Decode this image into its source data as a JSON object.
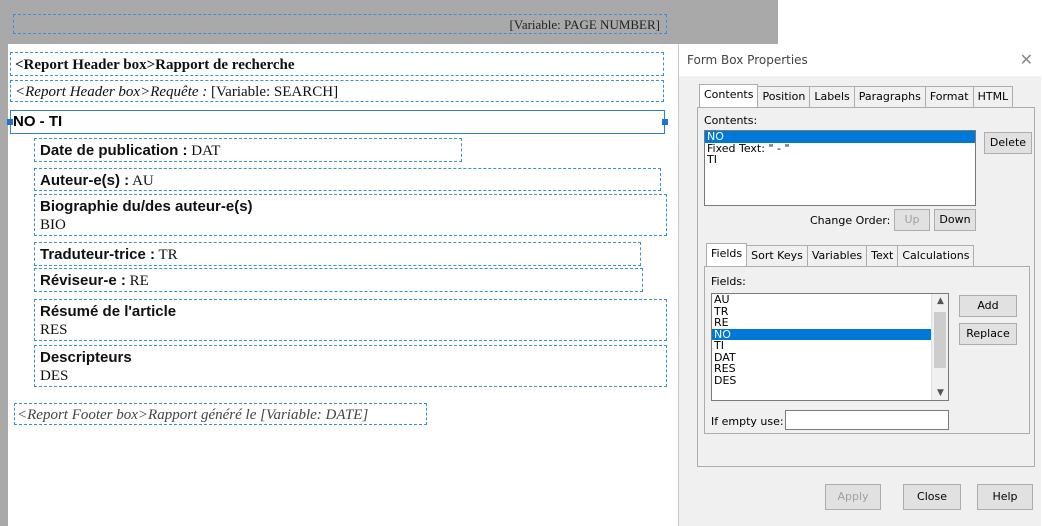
{
  "report": {
    "page_number_box": "[Variable: PAGE NUMBER]",
    "header1": "<Report Header box>Rapport de recherche",
    "header2_prefix": "<Report Header box>Requête :",
    "header2_variable": " [Variable: SEARCH]",
    "selected_box": "NO  - TI",
    "fields": [
      {
        "label": "Date de publication :",
        "value": " DAT"
      },
      {
        "label": "Auteur-e(s) :",
        "value": " AU"
      },
      {
        "label": "Biographie du/des auteur-e(s)",
        "value": "BIO"
      },
      {
        "label": "Traduteur-trice :",
        "value": " TR"
      },
      {
        "label": "Réviseur-e :",
        "value": " RE"
      },
      {
        "label": "Résumé de l'article",
        "value": "RES"
      },
      {
        "label": "Descripteurs",
        "value": "DES"
      }
    ],
    "footer": "<Report Footer box>Rapport généré le [Variable: DATE]"
  },
  "dialog": {
    "title": "Form Box Properties",
    "close_glyph": "✕",
    "tabs": [
      "Contents",
      "Position",
      "Labels",
      "Paragraphs",
      "Format",
      "HTML"
    ],
    "contents_label": "Contents:",
    "contents_items": [
      "NO",
      "Fixed Text: \" - \"",
      "TI"
    ],
    "delete_label": "Delete",
    "change_order_label": "Change Order:",
    "up_label": "Up",
    "down_label": "Down",
    "subtabs": [
      "Fields",
      "Sort Keys",
      "Variables",
      "Text",
      "Calculations"
    ],
    "fields_label": "Fields:",
    "fields_items": [
      "AU",
      "TR",
      "RE",
      "NO",
      "TI",
      "DAT",
      "RES",
      "DES"
    ],
    "selected_field": "NO",
    "add_label": "Add",
    "replace_label": "Replace",
    "if_empty_label": "If empty use:",
    "if_empty_value": "",
    "apply_label": "Apply",
    "close_label": "Close",
    "help_label": "Help"
  },
  "colors": {
    "selection": "#0078d7",
    "box_border": "#3c8fd6",
    "canvas_grey": "#a9a9a9"
  }
}
